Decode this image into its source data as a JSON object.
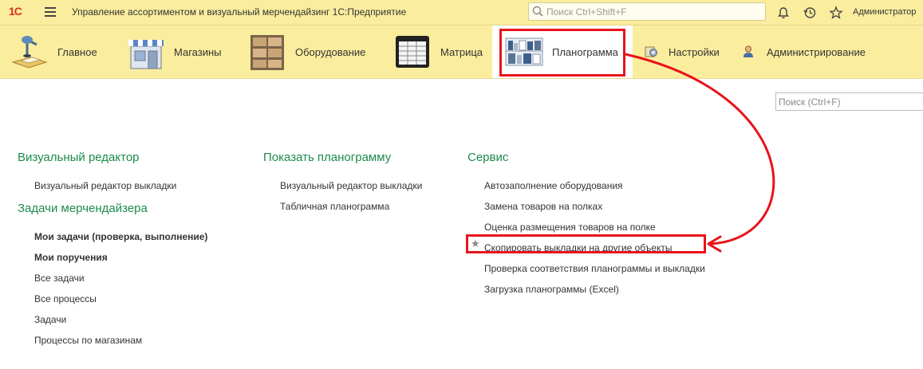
{
  "titlebar": {
    "logo": "1С",
    "app_title": "Управление ассортиментом  и визуальный мерчендайзинг 1С:Предприятие",
    "search_placeholder": "Поиск Ctrl+Shift+F",
    "user": "Администратор"
  },
  "sections": [
    {
      "label": "Главное",
      "icon": "desk-lamp-icon"
    },
    {
      "label": "Магазины",
      "icon": "storefront-icon"
    },
    {
      "label": "Оборудование",
      "icon": "shelving-icon"
    },
    {
      "label": "Матрица",
      "icon": "spreadsheet-icon"
    },
    {
      "label": "Планограмма",
      "icon": "planogram-icon",
      "active": true
    },
    {
      "label": "Настройки",
      "icon": "settings-icon"
    },
    {
      "label": "Администрирование",
      "icon": "admin-user-icon"
    }
  ],
  "content": {
    "search_placeholder": "Поиск (Ctrl+F)",
    "col1": {
      "group1_title": "Визуальный редактор",
      "group1_items": [
        "Визуальный редактор выкладки"
      ],
      "group2_title": "Задачи мерчендайзера",
      "group2_items": [
        "Мои задачи (проверка, выполнение)",
        "Мои поручения",
        "Все задачи",
        "Все процессы",
        "Задачи",
        "Процессы по магазинам"
      ]
    },
    "col2": {
      "group_title": "Показать планограмму",
      "items": [
        "Визуальный редактор выкладки",
        "Табличная планограмма"
      ]
    },
    "col3": {
      "group_title": "Сервис",
      "items": [
        "Автозаполнение оборудования",
        "Замена товаров на полках",
        "Оценка размещения товаров на полке",
        "Скопировать выкладки на другие объекты",
        "Проверка соответствия планограммы и выкладки",
        "Загрузка планограммы (Excel)"
      ]
    }
  },
  "colors": {
    "accent_green": "#1d8b4b",
    "highlight_red": "#e8141b",
    "bar_yellow": "#fbed9e"
  }
}
